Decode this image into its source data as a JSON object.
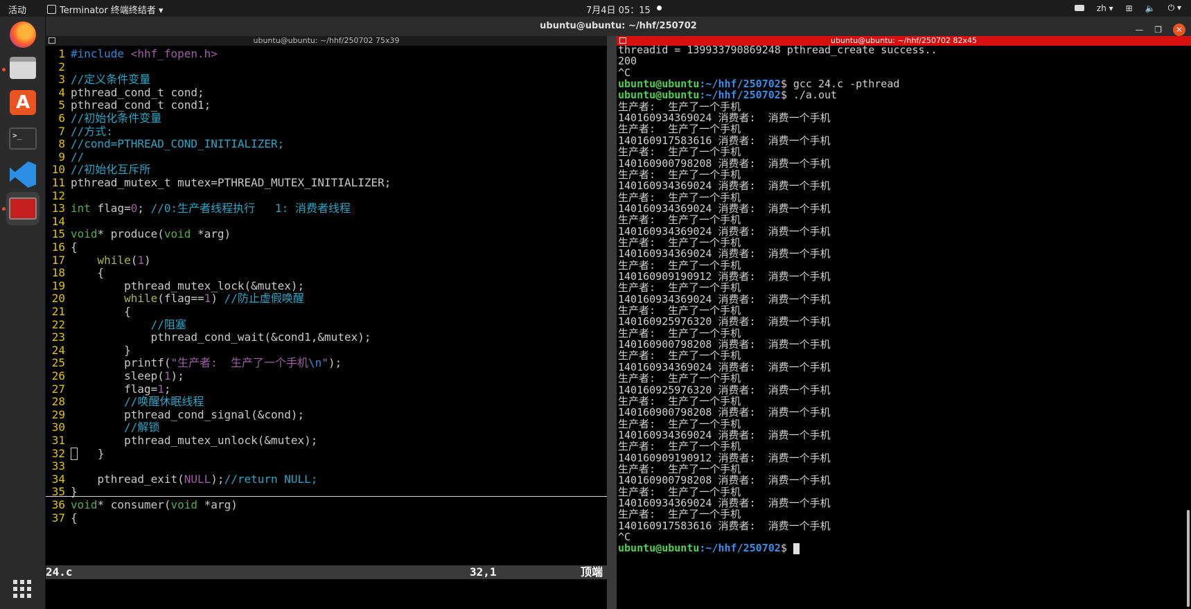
{
  "topbar": {
    "activities": "活动",
    "app_name": "Terminator 终端终结者 ▾",
    "clock": "7月4日  05：15",
    "lang": "zh ▾"
  },
  "window": {
    "title": "ubuntu@ubuntu: ~/hhf/250702",
    "left_pane_title": "ubuntu@ubuntu: ~/hhf/250702 75x39",
    "right_pane_title": "ubuntu@ubuntu: ~/hhf/250702 82x45"
  },
  "dock": {
    "items": [
      "firefox-icon",
      "files-icon",
      "software-store-icon",
      "terminal-icon",
      "vscode-icon",
      "terminator-icon",
      "app-grid-icon"
    ],
    "accent": "#e95420"
  },
  "editor": {
    "lines": [
      {
        "n": "1",
        "t": "#include <hhf_fopen.h>"
      },
      {
        "n": "2",
        "t": ""
      },
      {
        "n": "3",
        "t": "//定义条件变量"
      },
      {
        "n": "4",
        "t": "pthread_cond_t cond;"
      },
      {
        "n": "5",
        "t": "pthread_cond_t cond1;"
      },
      {
        "n": "6",
        "t": "//初始化条件变量"
      },
      {
        "n": "7",
        "t": "//方式:"
      },
      {
        "n": "8",
        "t": "//cond=PTHREAD_COND_INITIALIZER;"
      },
      {
        "n": "9",
        "t": "//"
      },
      {
        "n": "10",
        "t": "//初始化互斥所"
      },
      {
        "n": "11",
        "t": "pthread_mutex_t mutex=PTHREAD_MUTEX_INITIALIZER;"
      },
      {
        "n": "12",
        "t": ""
      },
      {
        "n": "13",
        "t": "int flag=0; //0:生产者线程执行   1: 消费者线程"
      },
      {
        "n": "14",
        "t": ""
      },
      {
        "n": "15",
        "t": "void* produce(void *arg)"
      },
      {
        "n": "16",
        "t": "{"
      },
      {
        "n": "17",
        "t": "    while(1)"
      },
      {
        "n": "18",
        "t": "    {"
      },
      {
        "n": "19",
        "t": "        pthread_mutex_lock(&mutex);"
      },
      {
        "n": "20",
        "t": "        while(flag==1) //防止虚假唤醒"
      },
      {
        "n": "21",
        "t": "        {"
      },
      {
        "n": "22",
        "t": "            //阻塞"
      },
      {
        "n": "23",
        "t": "            pthread_cond_wait(&cond1,&mutex);"
      },
      {
        "n": "24",
        "t": "        }"
      },
      {
        "n": "25",
        "t": "        printf(\"生产者:  生产了一个手机\\n\");"
      },
      {
        "n": "26",
        "t": "        sleep(1);"
      },
      {
        "n": "27",
        "t": "        flag=1;"
      },
      {
        "n": "28",
        "t": "        //唤醒休眠线程"
      },
      {
        "n": "29",
        "t": "        pthread_cond_signal(&cond);"
      },
      {
        "n": "30",
        "t": "        //解锁"
      },
      {
        "n": "31",
        "t": "        pthread_mutex_unlock(&mutex);"
      },
      {
        "n": "32",
        "t": "    }"
      },
      {
        "n": "33",
        "t": ""
      },
      {
        "n": "34",
        "t": "    pthread_exit(NULL);//return NULL;"
      },
      {
        "n": "35",
        "t": "}"
      },
      {
        "n": "36",
        "t": "void* consumer(void *arg)"
      },
      {
        "n": "37",
        "t": "{"
      }
    ],
    "status_file": "24.c",
    "status_pos": "32,1",
    "status_top": "顶端"
  },
  "terminal": {
    "prompt_user": "ubuntu@ubuntu",
    "prompt_path": ":~/hhf/250702",
    "lines": [
      "threadid = 139933790869248 pthread_create success..",
      "200",
      "^C",
      "__PROMPT__gcc 24.c -pthread",
      "__PROMPT__./a.out",
      "生产者:  生产了一个手机",
      "140160934369024 消费者:  消费一个手机",
      "生产者:  生产了一个手机",
      "140160917583616 消费者:  消费一个手机",
      "生产者:  生产了一个手机",
      "140160900798208 消费者:  消费一个手机",
      "生产者:  生产了一个手机",
      "140160934369024 消费者:  消费一个手机",
      "生产者:  生产了一个手机",
      "140160934369024 消费者:  消费一个手机",
      "生产者:  生产了一个手机",
      "140160934369024 消费者:  消费一个手机",
      "生产者:  生产了一个手机",
      "140160934369024 消费者:  消费一个手机",
      "生产者:  生产了一个手机",
      "140160909190912 消费者:  消费一个手机",
      "生产者:  生产了一个手机",
      "140160934369024 消费者:  消费一个手机",
      "生产者:  生产了一个手机",
      "140160925976320 消费者:  消费一个手机",
      "生产者:  生产了一个手机",
      "140160900798208 消费者:  消费一个手机",
      "生产者:  生产了一个手机",
      "140160934369024 消费者:  消费一个手机",
      "生产者:  生产了一个手机",
      "140160925976320 消费者:  消费一个手机",
      "生产者:  生产了一个手机",
      "140160900798208 消费者:  消费一个手机",
      "生产者:  生产了一个手机",
      "140160934369024 消费者:  消费一个手机",
      "生产者:  生产了一个手机",
      "140160909190912 消费者:  消费一个手机",
      "生产者:  生产了一个手机",
      "140160900798208 消费者:  消费一个手机",
      "生产者:  生产了一个手机",
      "140160934369024 消费者:  消费一个手机",
      "生产者:  生产了一个手机",
      "140160917583616 消费者:  消费一个手机",
      "^C",
      "__PROMPT__"
    ]
  }
}
